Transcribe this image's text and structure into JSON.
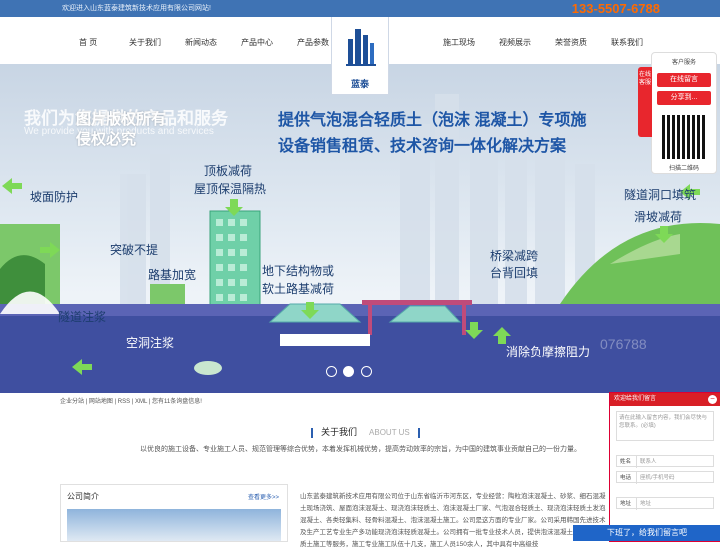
{
  "header": {
    "welcome": "欢迎进入山东蓝泰建筑新技术应用有限公司网站!",
    "phone": "133-5507-6788"
  },
  "nav": {
    "left": [
      "首 页",
      "关于我们",
      "新闻动态",
      "产品中心",
      "产品参数"
    ],
    "right": [
      "施工现场",
      "视频展示",
      "荣誉资质",
      "联系我们"
    ],
    "logo_text": "蓝泰"
  },
  "banner": {
    "ghost_line1": "我们为您提供的产品和服务",
    "ghost_line2": "We provide you with products and services",
    "watermark1": "图片版权所有",
    "watermark2": "侵权必究",
    "headline1": "提供气泡混合轻质土（泡沫 混凝土）专项施",
    "headline2": "设备销售租赁、技术咨询一体化解决方案",
    "labels": {
      "slope": "坡面防护",
      "roof1": "顶板减荷",
      "roof2": "屋顶保温隔热",
      "breakthrough": "突破不提",
      "roadbed": "路基加宽",
      "underground1": "地下结构物或",
      "underground2": "软土路基减荷",
      "tunnel_fill": "隧道注浆",
      "cavity": "空洞注浆",
      "tunnel_entry": "隧道洞口填筑",
      "landslide": "滑坡减荷",
      "bridge1": "桥梁减跨",
      "bridge2": "台背回填",
      "friction": "消除负摩擦阻力",
      "phone_ghost": "076788"
    },
    "slides": 3,
    "active_slide": 2
  },
  "sitebar": "企业分站 | 网站地图 | RSS | XML | 您有11条询盘信息!",
  "about": {
    "title": "关于我们",
    "title_en": "ABOUT US",
    "desc": "以优良的施工设备、专业施工人员、规范管理等综合优势，本着发挥机械优势，提高劳动效率的宗旨，为中国的建筑事业贡献自己的一份力量。",
    "profile_title": "公司简介",
    "more": "查看更多>>",
    "intro": "山东蓝泰建筑新技术应用有限公司位于山东省临沂市河东区，专业经营：陶粒泡沫混凝土、砂浆、细石混凝土现场浇筑、屋面泡沫混凝土、现浇泡沫轻质土、泡沫混凝土厂家、气泡混合轻质土、现浇泡沫轻质土发泡混凝土、各类轻集料、轻骨料混凝土、泡沫混凝土施工。公司是这方面的专业厂家。公司采用韩国先进技术及生产工艺专业生产多功能现浇泡沫轻质混凝土。公司拥有一批专业技术人员，提供泡沫混凝土现浇泡沫轻质土施工等服务，施工专业施工队伍十几支，施工人员150余人，其中具有中高级技"
  },
  "service": {
    "title": "客户服务",
    "tab": "在线客服",
    "btn1": "在线留言",
    "btn2": "分享到...",
    "qr_label": "扫描二维码"
  },
  "message": {
    "header": "欢迎给我们留言",
    "close": "−",
    "placeholder": "请在此输入留言内容，我们会尽快与您联系。(必填)",
    "name_label": "姓名",
    "name_ph": "联系人",
    "phone_label": "电话",
    "phone_ph": "座机/手机号码",
    "addr_label": "地址",
    "addr_ph": "地址",
    "submit": "下班了，给我们留言吧"
  },
  "colors": {
    "topbar": "#3f73b4",
    "accent_red": "#e8262d",
    "headline_blue": "#1e56a6",
    "submit_blue": "#1f65c8",
    "phone_orange": "#ff6a00"
  }
}
